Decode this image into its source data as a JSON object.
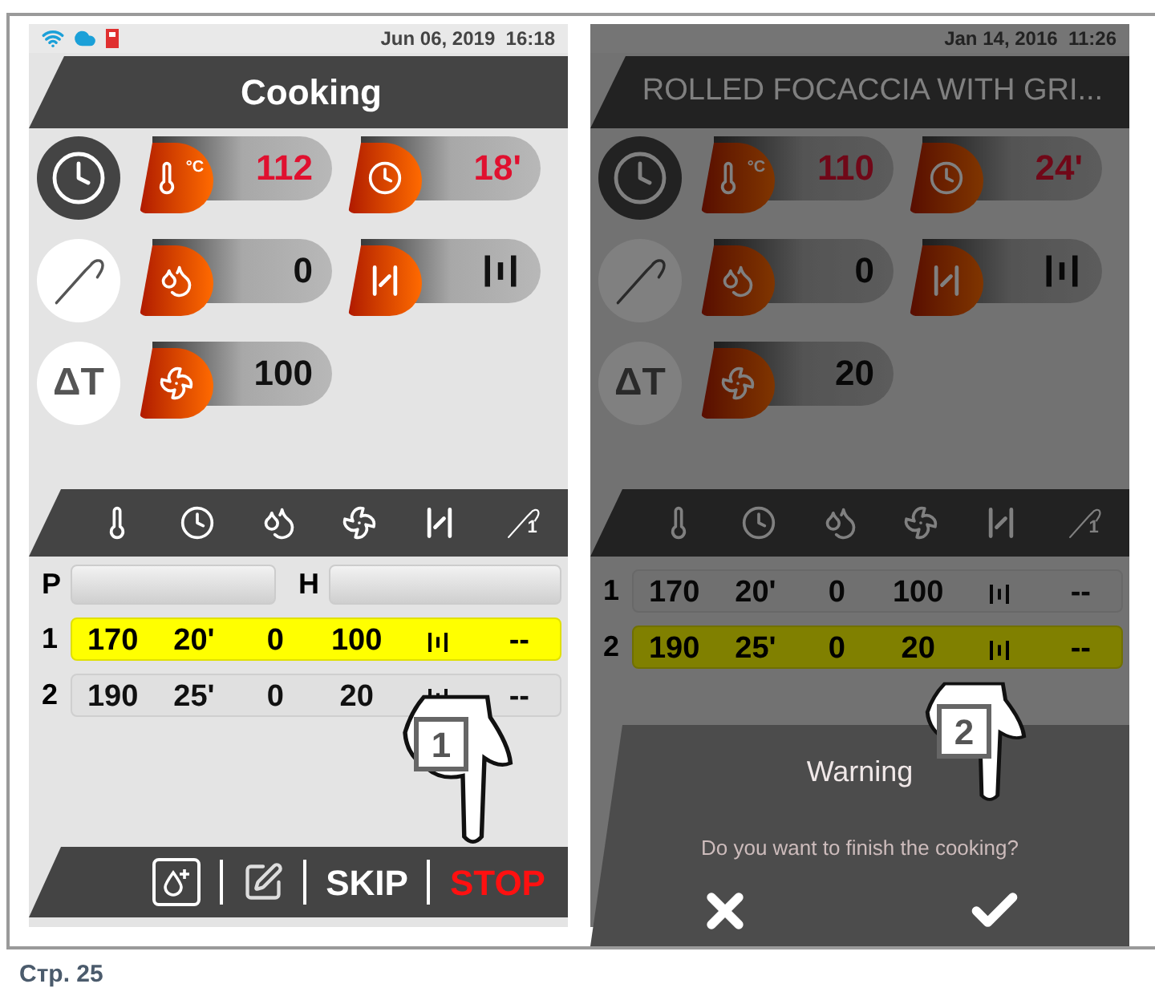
{
  "screens": [
    {
      "dimmed": false,
      "connectivity_shown": true,
      "datetime": "Jun 06, 2019  16:18",
      "title": "Cooking",
      "modes": [
        {
          "kind": "timer",
          "selected": true
        },
        {
          "kind": "probe",
          "selected": false
        },
        {
          "kind": "delta",
          "label": "ΔT",
          "selected": false
        }
      ],
      "params": [
        {
          "kind": "temperature",
          "unit": "°C",
          "value": "112"
        },
        {
          "kind": "time",
          "value": "18'"
        },
        {
          "kind": "humidity",
          "value": "0"
        },
        {
          "kind": "vent"
        },
        {
          "kind": "fan",
          "value": "100"
        }
      ],
      "columns": [
        {
          "kind": "temperature"
        },
        {
          "kind": "time"
        },
        {
          "kind": "humidity"
        },
        {
          "kind": "fan"
        },
        {
          "kind": "vent"
        },
        {
          "kind": "probe",
          "label": "1"
        }
      ],
      "preheat": {
        "p": "P",
        "h": "H"
      },
      "steps": [
        {
          "number": "1",
          "values": [
            "170",
            "20'",
            "0",
            "100",
            "--"
          ],
          "selected": true
        },
        {
          "number": "2",
          "values": [
            "190",
            "25'",
            "0",
            "20",
            "--"
          ],
          "selected": false
        }
      ],
      "toolbar": [
        {
          "kind": "add_steam"
        },
        {
          "kind": "edit"
        },
        {
          "kind": "skip",
          "label": "SKIP"
        },
        {
          "kind": "stop",
          "label": "STOP"
        }
      ],
      "callout": "1"
    },
    {
      "dimmed": true,
      "connectivity_shown": false,
      "datetime": "Jan 14, 2016  11:26",
      "title": "ROLLED FOCACCIA WITH GRI...",
      "modes": [
        {
          "kind": "timer",
          "selected": true
        },
        {
          "kind": "probe",
          "selected": false
        },
        {
          "kind": "delta",
          "label": "ΔT",
          "selected": false
        }
      ],
      "params": [
        {
          "kind": "temperature",
          "unit": "°C",
          "value": "110"
        },
        {
          "kind": "time",
          "value": "24'"
        },
        {
          "kind": "humidity",
          "value": "0"
        },
        {
          "kind": "vent"
        },
        {
          "kind": "fan",
          "value": "20"
        }
      ],
      "columns": [
        {
          "kind": "temperature"
        },
        {
          "kind": "time"
        },
        {
          "kind": "humidity"
        },
        {
          "kind": "fan"
        },
        {
          "kind": "vent"
        },
        {
          "kind": "probe",
          "label": "1"
        }
      ],
      "steps": [
        {
          "number": "1",
          "values": [
            "170",
            "20'",
            "0",
            "100",
            "--"
          ],
          "selected": false
        },
        {
          "number": "2",
          "values": [
            "190",
            "25'",
            "0",
            "20",
            "--"
          ],
          "selected": true
        }
      ],
      "dialog": {
        "title": "Warning",
        "message": "Do you want to finish the cooking?",
        "actions": [
          {
            "kind": "cancel"
          },
          {
            "kind": "confirm"
          }
        ]
      },
      "callout": "2"
    }
  ],
  "page_label": "Стр. 25"
}
